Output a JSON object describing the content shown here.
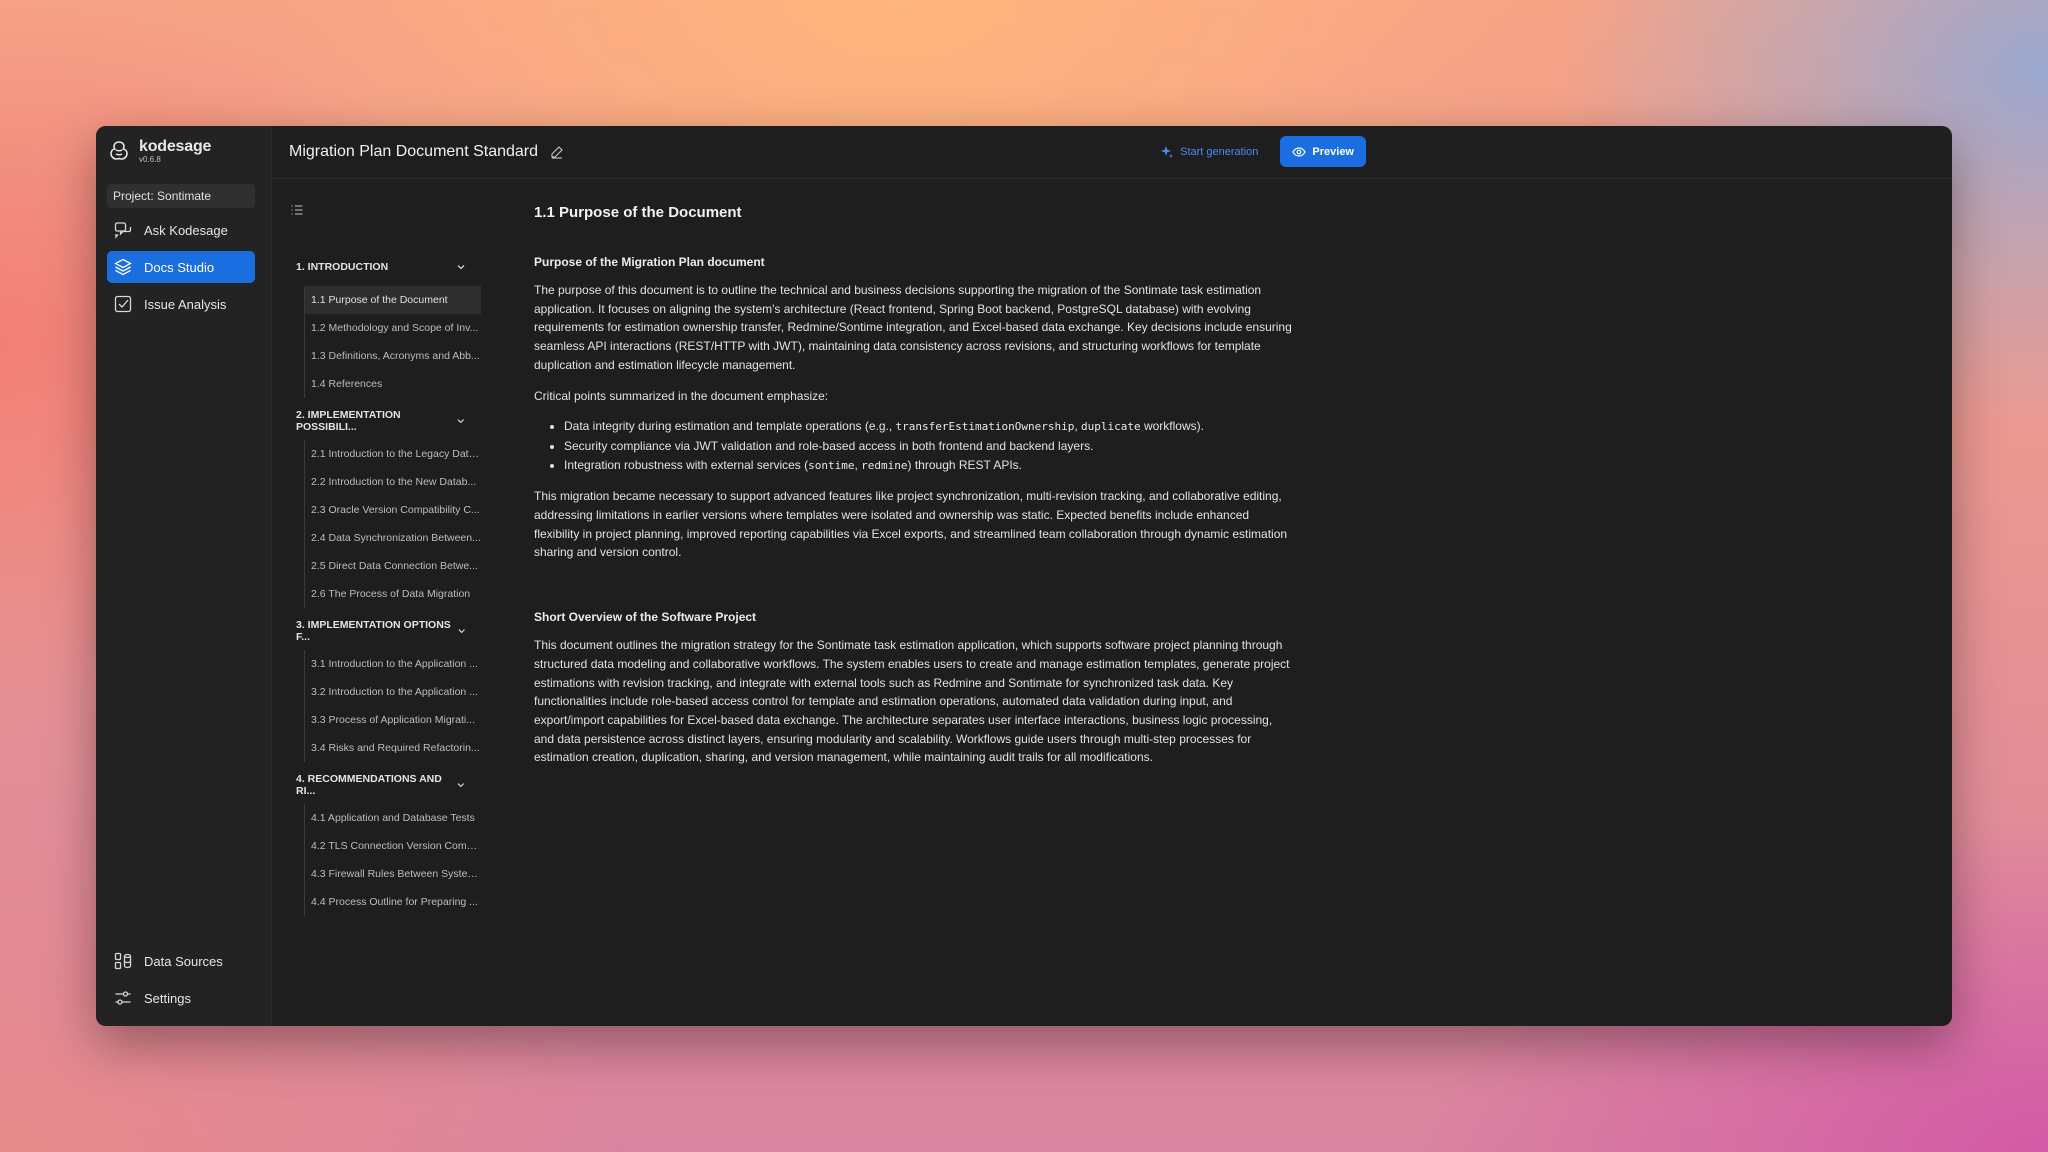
{
  "app": {
    "brand_name": "kodesage",
    "version": "v0.6.8",
    "project": "Project: Sontimate"
  },
  "nav": {
    "items": [
      {
        "label": "Ask Kodesage",
        "icon": "chat-icon"
      },
      {
        "label": "Docs Studio",
        "icon": "layers-icon",
        "active": true
      },
      {
        "label": "Issue Analysis",
        "icon": "checkbox-icon"
      }
    ],
    "bottom": [
      {
        "label": "Data Sources",
        "icon": "data-sources-icon"
      },
      {
        "label": "Settings",
        "icon": "sliders-icon"
      }
    ]
  },
  "header": {
    "title": "Migration Plan Document Standard",
    "start_generation": "Start generation",
    "preview": "Preview"
  },
  "toc": {
    "sections": [
      {
        "label": "1. INTRODUCTION",
        "items": [
          "1.1 Purpose of the Document",
          "1.2 Methodology and Scope of Inv...",
          "1.3 Definitions, Acronyms and Abb...",
          "1.4 References"
        ]
      },
      {
        "label": "2. IMPLEMENTATION POSSIBILI...",
        "items": [
          "2.1 Introduction to the Legacy Data...",
          "2.2 Introduction to the New Datab...",
          "2.3 Oracle Version Compatibility C...",
          "2.4 Data Synchronization Between...",
          "2.5 Direct Data Connection Betwe...",
          "2.6 The Process of Data Migration"
        ]
      },
      {
        "label": "3. IMPLEMENTATION OPTIONS F...",
        "items": [
          "3.1 Introduction to the Application ...",
          "3.2 Introduction to the Application ...",
          "3.3 Process of Application Migrati...",
          "3.4 Risks and Required Refactorin..."
        ]
      },
      {
        "label": "4. RECOMMENDATIONS AND RI...",
        "items": [
          "4.1 Application and Database Tests",
          "4.2 TLS Connection Version Comp...",
          "4.3 Firewall Rules Between Systems",
          "4.4 Process Outline for Preparing ..."
        ]
      }
    ]
  },
  "doc": {
    "title": "1.1 Purpose of the Document",
    "sub1": "Purpose of the Migration Plan document",
    "p1": "The purpose of this document is to outline the technical and business decisions supporting the migration of the Sontimate task estimation application. It focuses on aligning the system's architecture (React frontend, Spring Boot backend, PostgreSQL database) with evolving requirements for estimation ownership transfer, Redmine/Sontime integration, and Excel-based data exchange. Key decisions include ensuring seamless API interactions (REST/HTTP with JWT), maintaining data consistency across revisions, and structuring workflows for template duplication and estimation lifecycle management.",
    "p2": "Critical points summarized in the document emphasize:",
    "b1_pre": "Data integrity during estimation and template operations (e.g., ",
    "b1_code1": "transferEstimationOwnership",
    "b1_sep": ", ",
    "b1_code2": "duplicate",
    "b1_post": " workflows).",
    "b2": "Security compliance via JWT validation and role-based access in both frontend and backend layers.",
    "b3_pre": "Integration robustness with external services (",
    "b3_code1": "sontime",
    "b3_sep": ", ",
    "b3_code2": "redmine",
    "b3_post": ") through REST APIs.",
    "p3": "This migration became necessary to support advanced features like project synchronization, multi-revision tracking, and collaborative editing, addressing limitations in earlier versions where templates were isolated and ownership was static. Expected benefits include enhanced flexibility in project planning, improved reporting capabilities via Excel exports, and streamlined team collaboration through dynamic estimation sharing and version control.",
    "sub2": "Short Overview of the Software Project",
    "p4": "This document outlines the migration strategy for the Sontimate task estimation application, which supports software project planning through structured data modeling and collaborative workflows. The system enables users to create and manage estimation templates, generate project estimations with revision tracking, and integrate with external tools such as Redmine and Sontimate for synchronized task data. Key functionalities include role-based access control for template and estimation operations, automated data validation during input, and export/import capabilities for Excel-based data exchange. The architecture separates user interface interactions, business logic processing, and data persistence across distinct layers, ensuring modularity and scalability. Workflows guide users through multi-step processes for estimation creation, duplication, sharing, and version management, while maintaining audit trails for all modifications."
  }
}
